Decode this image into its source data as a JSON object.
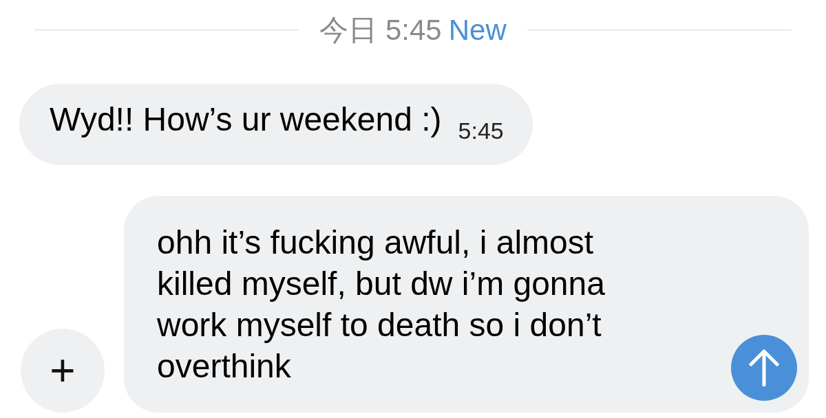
{
  "divider": {
    "date": "今日 5:45",
    "new_label": "New"
  },
  "messages": [
    {
      "text": "Wyd!! How’s ur weekend :)",
      "time": "5:45",
      "incoming": true
    }
  ],
  "composer": {
    "add_button": "+",
    "value": "ohh it’s fucking awful, i almost killed myself, but dw i’m gonna work myself to death so i don’t overthink"
  }
}
